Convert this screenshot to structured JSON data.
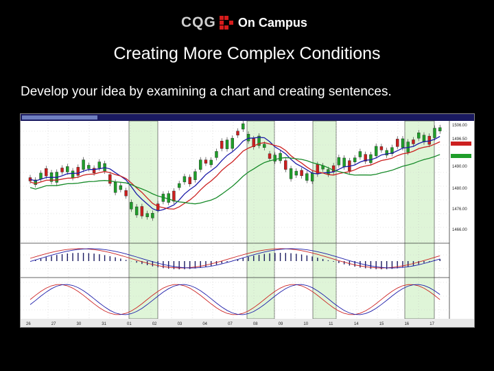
{
  "logo": {
    "brand": "CQG",
    "product": "On Campus"
  },
  "slide": {
    "title": "Creating More Complex Conditions",
    "subtitle": "Develop your idea by examining a chart and creating sentences."
  },
  "chart_window": {
    "type": "candlestick",
    "highlight_color": "#dff5d8",
    "candle_up_color": "#1f9e2a",
    "candle_down_color": "#cc1f1f",
    "ma_colors": [
      "#1a1aa8",
      "#cc2020",
      "#168a28"
    ],
    "panels": [
      "price",
      "macd",
      "stochastics"
    ],
    "price_labels": [
      "1506.00",
      "1496.50",
      "1490.00",
      "1480.00",
      "1476.00",
      "1466.00"
    ],
    "date_labels": [
      "26",
      "27",
      "30",
      "31",
      "01",
      "02",
      "03",
      "04",
      "07",
      "08",
      "09",
      "10",
      "11",
      "14",
      "15",
      "16",
      "17"
    ]
  }
}
